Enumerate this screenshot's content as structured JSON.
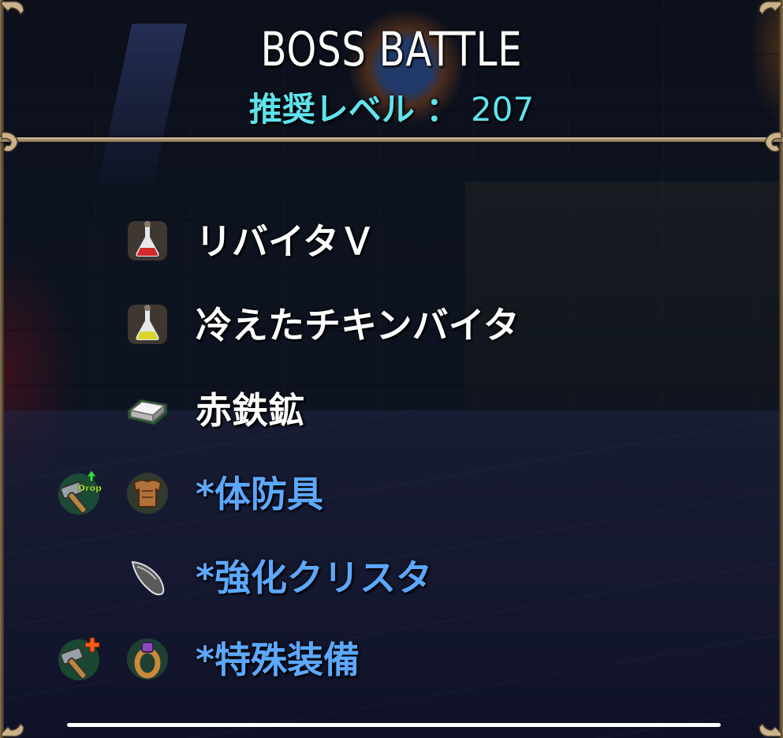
{
  "header": {
    "title": "BOSS BATTLE",
    "recommended_level_label": "推奨レベル ：",
    "recommended_level_value": "207"
  },
  "items": [
    {
      "label": "リバイタＶ",
      "icon": "red-potion-flask-icon",
      "style": "normal",
      "modifier_icon": null
    },
    {
      "label": "冷えたチキンバイタ",
      "icon": "yellow-potion-flask-icon",
      "style": "normal",
      "modifier_icon": null
    },
    {
      "label": "赤鉄鉱",
      "icon": "iron-ingot-icon",
      "style": "normal",
      "modifier_icon": null
    },
    {
      "label": "*体防具",
      "icon": "body-armor-icon",
      "style": "highlight",
      "modifier_icon": "drop-up-hammer-icon",
      "modifier_text": "Drop"
    },
    {
      "label": "*強化クリスタ",
      "icon": "crystal-shard-icon",
      "style": "highlight",
      "modifier_icon": null
    },
    {
      "label": "*特殊装備",
      "icon": "ring-icon",
      "style": "highlight",
      "modifier_icon": "plus-hammer-icon"
    }
  ],
  "colors": {
    "title": "#ffffff",
    "level": "#5fe3ee",
    "normal_item": "#ffffff",
    "highlight_item": "#5ca8ff",
    "frame": "#cbb592"
  }
}
